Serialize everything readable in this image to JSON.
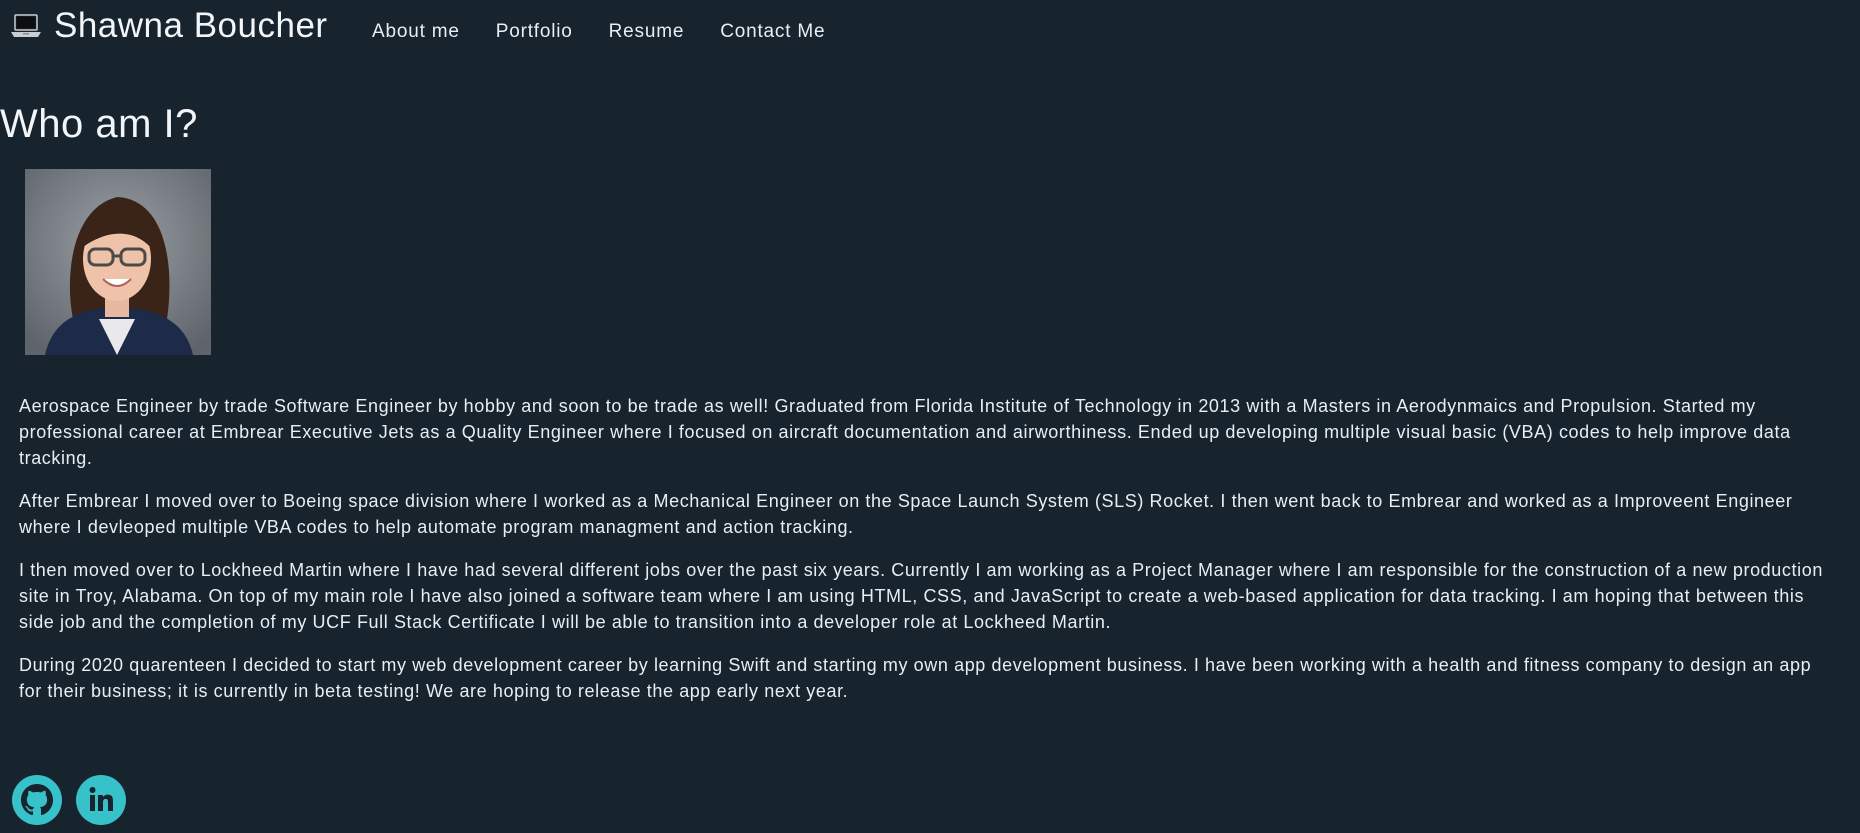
{
  "header": {
    "brand": "Shawna Boucher",
    "brand_icon": "laptop-icon",
    "nav": [
      {
        "label": "About me"
      },
      {
        "label": "Portfolio"
      },
      {
        "label": "Resume"
      },
      {
        "label": "Contact Me"
      }
    ]
  },
  "main": {
    "title": "Who am I?",
    "paragraphs": [
      "Aerospace Engineer by trade Software Engineer by hobby and soon to be trade as well! Graduated from Florida Institute of Technology in 2013 with a Masters in Aerodynmaics and Propulsion. Started my professional career at Embrear Executive Jets as a Quality Engineer where I focused on aircraft documentation and airworthiness. Ended up developing multiple visual basic (VBA) codes to help improve data tracking.",
      "After Embrear I moved over to Boeing space division where I worked as a Mechanical Engineer on the Space Launch System (SLS) Rocket. I then went back to Embrear and worked as a Improveent Engineer where I devleoped multiple VBA codes to help automate program managment and action tracking.",
      "I then moved over to Lockheed Martin where I have had several different jobs over the past six years. Currently I am working as a Project Manager where I am responsible for the construction of a new production site in Troy, Alabama. On top of my main role I have also joined a software team where I am using HTML, CSS, and JavaScript to create a web-based application for data tracking. I am hoping that between this side job and the completion of my UCF Full Stack Certificate I will be able to transition into a developer role at Lockheed Martin.",
      "During 2020 quarenteen I decided to start my web development career by learning Swift and starting my own app development business. I have been working with a health and fitness company to design an app for their business; it is currently in beta testing! We are hoping to release the app early next year."
    ]
  },
  "footer": {
    "social": [
      {
        "icon": "github-icon"
      },
      {
        "icon": "linkedin-icon"
      }
    ]
  },
  "colors": {
    "background": "#17232d",
    "text": "#e8eef2",
    "accent": "#37c1c8"
  }
}
